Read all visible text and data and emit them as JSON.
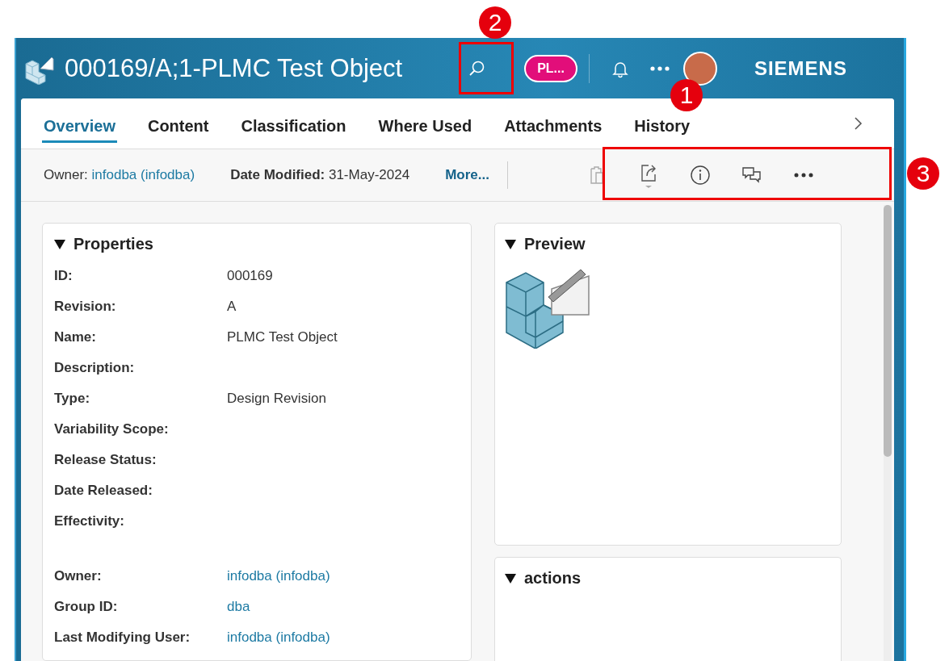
{
  "header": {
    "title": "000169/A;1-PLMC Test Object",
    "user_badge": "PL...",
    "brand": "SIEMENS"
  },
  "tabs": [
    {
      "label": "Overview",
      "selected": true
    },
    {
      "label": "Content",
      "selected": false
    },
    {
      "label": "Classification",
      "selected": false
    },
    {
      "label": "Where Used",
      "selected": false
    },
    {
      "label": "Attachments",
      "selected": false
    },
    {
      "label": "History",
      "selected": false
    }
  ],
  "info_bar": {
    "owner_label": "Owner:",
    "owner_value": "infodba (infodba)",
    "date_label": "Date Modified:",
    "date_value": "31-May-2024",
    "more": "More..."
  },
  "properties": {
    "title": "Properties",
    "expanded": true,
    "groups": [
      {
        "rows": [
          {
            "label": "ID:",
            "value": "000169",
            "kind": "text"
          },
          {
            "label": "Revision:",
            "value": "A",
            "kind": "text"
          },
          {
            "label": "Name:",
            "value": "PLMC Test Object",
            "kind": "text"
          },
          {
            "label": "Description:"
          },
          {
            "label": "Type:",
            "value": "Design Revision",
            "kind": "text"
          },
          {
            "label": "Variability Scope:"
          },
          {
            "label": "Release Status:"
          },
          {
            "label": "Date Released:"
          },
          {
            "label": "Effectivity:"
          }
        ]
      },
      {
        "rows": [
          {
            "label": "Owner:",
            "value": "infodba (infodba)",
            "kind": "link"
          },
          {
            "label": "Group ID:",
            "value": "dba",
            "kind": "link"
          },
          {
            "label": "Last Modifying User:",
            "value": "infodba (infodba)",
            "kind": "link"
          }
        ]
      }
    ]
  },
  "preview": {
    "title": "Preview",
    "expanded": true
  },
  "actions": {
    "title": "actions",
    "expanded": true
  },
  "callouts": [
    {
      "label": "2"
    },
    {
      "label": "1"
    },
    {
      "label": "3"
    }
  ]
}
